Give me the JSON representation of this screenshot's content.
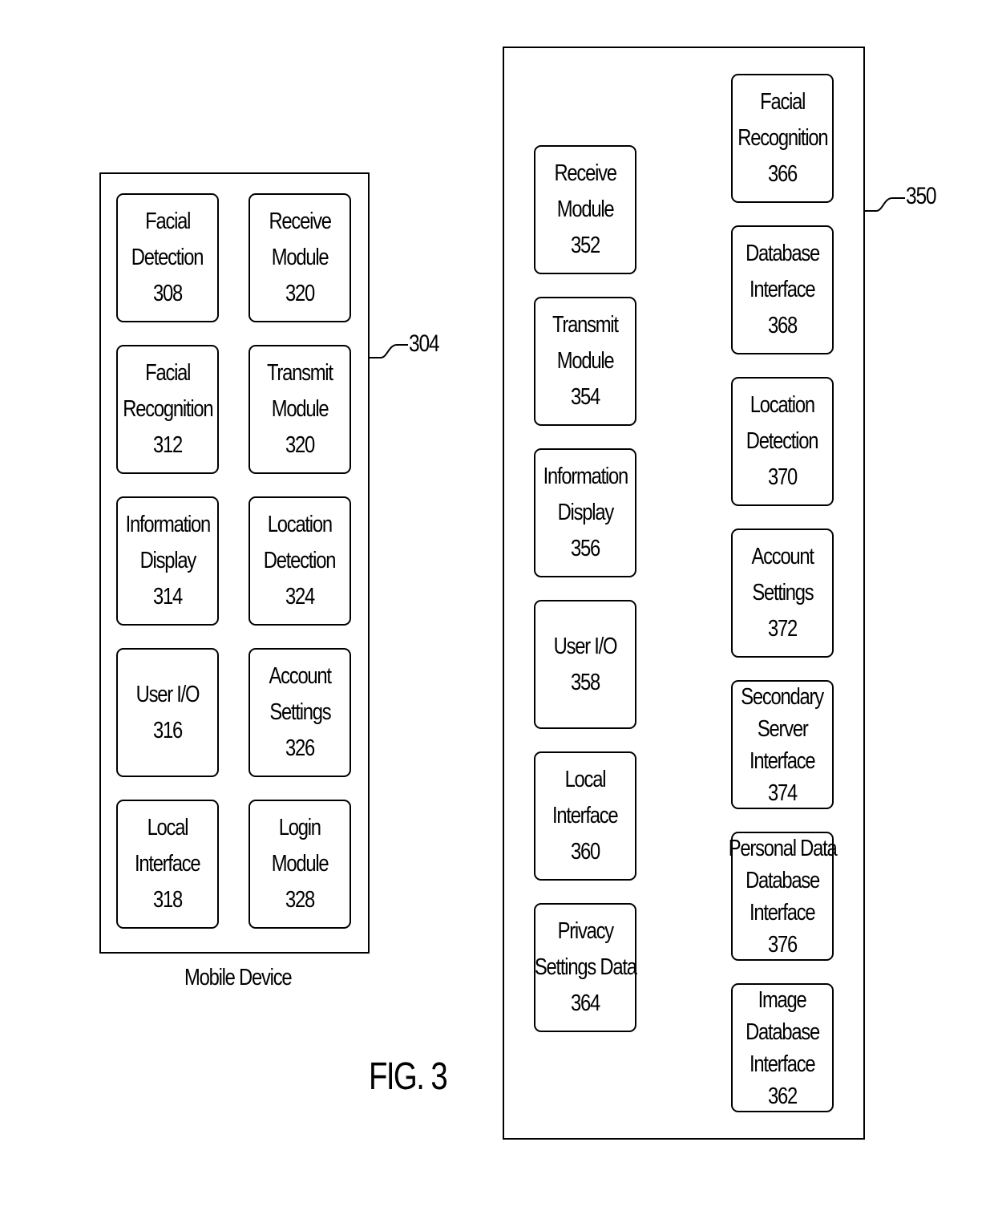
{
  "figure_label": "FIG. 3",
  "mobile_device": {
    "caption": "Mobile Device",
    "ref": "304",
    "modules": [
      {
        "lines": [
          "Facial",
          "Detection",
          "308"
        ]
      },
      {
        "lines": [
          "Receive",
          "Module",
          "320"
        ]
      },
      {
        "lines": [
          "Facial",
          "Recognition",
          "312"
        ]
      },
      {
        "lines": [
          "Transmit",
          "Module",
          "320"
        ]
      },
      {
        "lines": [
          "Information",
          "Display",
          "314"
        ]
      },
      {
        "lines": [
          "Location",
          "Detection",
          "324"
        ]
      },
      {
        "lines": [
          "User I/O",
          "316"
        ]
      },
      {
        "lines": [
          "Account",
          "Settings",
          "326"
        ]
      },
      {
        "lines": [
          "Local",
          "Interface",
          "318"
        ]
      },
      {
        "lines": [
          "Login",
          "Module",
          "328"
        ]
      }
    ]
  },
  "server": {
    "ref": "350",
    "left_modules": [
      {
        "lines": [
          "Receive",
          "Module",
          "352"
        ]
      },
      {
        "lines": [
          "Transmit",
          "Module",
          "354"
        ]
      },
      {
        "lines": [
          "Information",
          "Display",
          "356"
        ]
      },
      {
        "lines": [
          "User I/O",
          "358"
        ]
      },
      {
        "lines": [
          "Local",
          "Interface",
          "360"
        ]
      },
      {
        "lines": [
          "Privacy",
          "Settings Data",
          "364"
        ]
      }
    ],
    "right_modules": [
      {
        "lines": [
          "Facial",
          "Recognition",
          "366"
        ]
      },
      {
        "lines": [
          "Database",
          "Interface",
          "368"
        ]
      },
      {
        "lines": [
          "Location",
          "Detection",
          "370"
        ]
      },
      {
        "lines": [
          "Account",
          "Settings",
          "372"
        ]
      },
      {
        "lines": [
          "Secondary",
          "Server",
          "Interface",
          "374"
        ]
      },
      {
        "lines": [
          "Personal Data",
          "Database",
          "Interface",
          "376"
        ]
      },
      {
        "lines": [
          "Image",
          "Database",
          "Interface",
          "362"
        ]
      }
    ]
  }
}
